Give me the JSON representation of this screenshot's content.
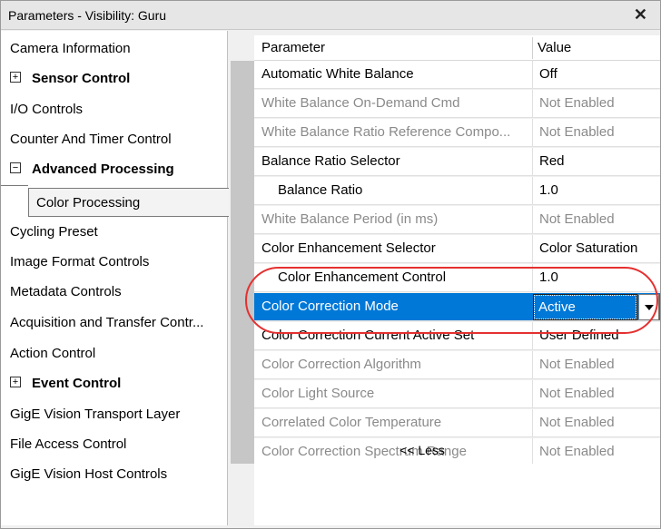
{
  "window": {
    "title": "Parameters - Visibility: Guru",
    "close_label": "✕"
  },
  "tree": {
    "items": [
      {
        "label": "Camera Information",
        "bold": false,
        "expander": ""
      },
      {
        "label": "Sensor Control",
        "bold": true,
        "expander": "+"
      },
      {
        "label": "I/O Controls",
        "bold": false,
        "expander": ""
      },
      {
        "label": "Counter And Timer Control",
        "bold": false,
        "expander": ""
      },
      {
        "label": "Advanced Processing",
        "bold": true,
        "expander": "−"
      },
      {
        "label": "Color Processing",
        "bold": false,
        "expander": "",
        "selected": true
      },
      {
        "label": "Cycling Preset",
        "bold": false,
        "expander": ""
      },
      {
        "label": "Image Format Controls",
        "bold": false,
        "expander": ""
      },
      {
        "label": "Metadata Controls",
        "bold": false,
        "expander": ""
      },
      {
        "label": "Acquisition and Transfer Contr...",
        "bold": false,
        "expander": ""
      },
      {
        "label": "Action Control",
        "bold": false,
        "expander": ""
      },
      {
        "label": "Event Control",
        "bold": true,
        "expander": "+"
      },
      {
        "label": "GigE Vision Transport Layer",
        "bold": false,
        "expander": ""
      },
      {
        "label": "File Access Control",
        "bold": false,
        "expander": ""
      },
      {
        "label": "GigE Vision Host Controls",
        "bold": false,
        "expander": ""
      }
    ]
  },
  "grid": {
    "header": {
      "parameter": "Parameter",
      "value": "Value"
    },
    "rows": [
      {
        "parameter": "Automatic White Balance",
        "value": "Off",
        "enabled": true
      },
      {
        "parameter": "White Balance On-Demand Cmd",
        "value": "Not Enabled",
        "enabled": false
      },
      {
        "parameter": "White Balance Ratio Reference Compo...",
        "value": "Not Enabled",
        "enabled": false
      },
      {
        "parameter": "Balance Ratio Selector",
        "value": "Red",
        "enabled": true
      },
      {
        "parameter": "Balance Ratio",
        "value": "1.0",
        "enabled": true,
        "indent": true
      },
      {
        "parameter": "White Balance Period (in ms)",
        "value": "Not Enabled",
        "enabled": false
      },
      {
        "parameter": "Color Enhancement Selector",
        "value": "Color Saturation",
        "enabled": true
      },
      {
        "parameter": "Color Enhancement Control",
        "value": "1.0",
        "enabled": true,
        "indent": true
      },
      {
        "parameter": "Color Correction Mode",
        "value": "Active",
        "enabled": true,
        "selected": true,
        "combo": true
      },
      {
        "parameter": "Color Correction Current Active Set",
        "value": "User Defined",
        "enabled": true
      },
      {
        "parameter": "Color Correction Algorithm",
        "value": "Not Enabled",
        "enabled": false
      },
      {
        "parameter": "Color Light Source",
        "value": "Not Enabled",
        "enabled": false
      },
      {
        "parameter": "Correlated Color Temperature",
        "value": "Not Enabled",
        "enabled": false
      },
      {
        "parameter": "Color Correction Spectrum Range",
        "value": "Not Enabled",
        "enabled": false
      }
    ],
    "less_label": "<< Less"
  },
  "colors": {
    "selection": "#0078d7",
    "annotation_outline": "#e53030",
    "disabled_text": "#8a8a8a"
  }
}
